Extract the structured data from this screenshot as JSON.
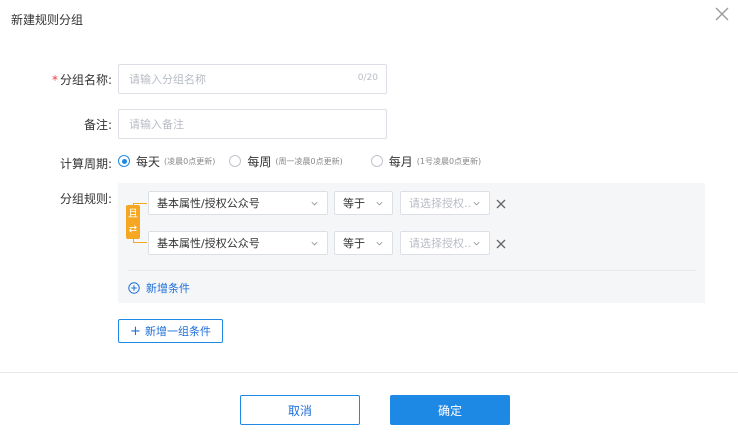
{
  "dialog": {
    "title": "新建规则分组",
    "close_icon": "close-icon"
  },
  "form": {
    "name": {
      "required_mark": "*",
      "label": "分组名称:",
      "placeholder": "请输入分组名称",
      "counter": "0/20"
    },
    "remark": {
      "label": "备注:",
      "placeholder": "请输入备注"
    },
    "cycle": {
      "label": "计算周期:",
      "options": [
        {
          "label": "每天",
          "hint": "(凌晨0点更新)",
          "selected": true
        },
        {
          "label": "每周",
          "hint": "(周一凌晨0点更新)",
          "selected": false
        },
        {
          "label": "每月",
          "hint": "(1号凌晨0点更新)",
          "selected": false
        }
      ]
    },
    "rules": {
      "label": "分组规则:",
      "logic_badge_top": "且",
      "logic_badge_bottom": "⇄",
      "conditions": [
        {
          "field": "基本属性/授权公众号",
          "operator": "等于",
          "value_placeholder": "请选择授权..."
        },
        {
          "field": "基本属性/授权公众号",
          "operator": "等于",
          "value_placeholder": "请选择授权..."
        }
      ],
      "add_condition": "新增条件",
      "add_group": "新增一组条件",
      "add_group_plus": "+"
    }
  },
  "footer": {
    "cancel": "取消",
    "ok": "确定"
  },
  "colors": {
    "primary": "#1e88e5",
    "bracket": "#f5a623",
    "required": "#e64340",
    "panel": "#f5f6f8"
  }
}
